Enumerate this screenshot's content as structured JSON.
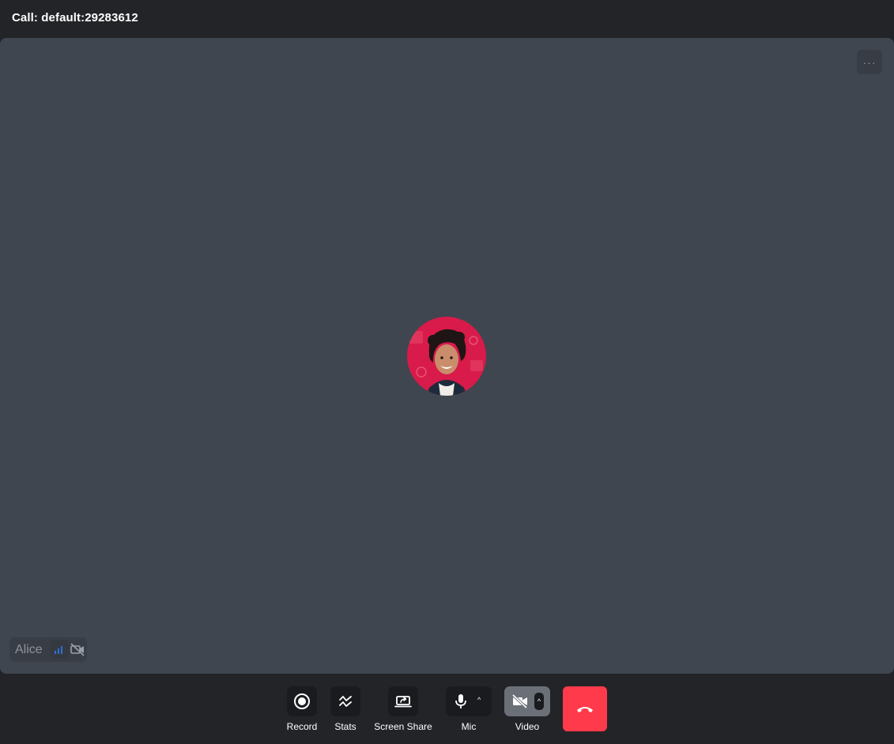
{
  "header": {
    "call_title": "Call: default:29283612"
  },
  "stage": {
    "more_options_icon": "ellipsis-icon",
    "participant": {
      "name": "Alice",
      "avatar": "participant-avatar",
      "signal_icon": "signal-strength-icon",
      "camera_state_icon": "video-off-icon"
    }
  },
  "controls": {
    "record_label": "Record",
    "stats_label": "Stats",
    "screen_share_label": "Screen Share",
    "mic_label": "Mic",
    "video_label": "Video",
    "leave_icon": "hang-up-icon"
  },
  "colors": {
    "stage_bg": "#40464f",
    "app_bg": "#232428",
    "button_bg": "#1a1b1e",
    "video_active_bg": "#6b7078",
    "leave_bg": "#ff3a4a",
    "signal_blue": "#2f6fd1"
  }
}
